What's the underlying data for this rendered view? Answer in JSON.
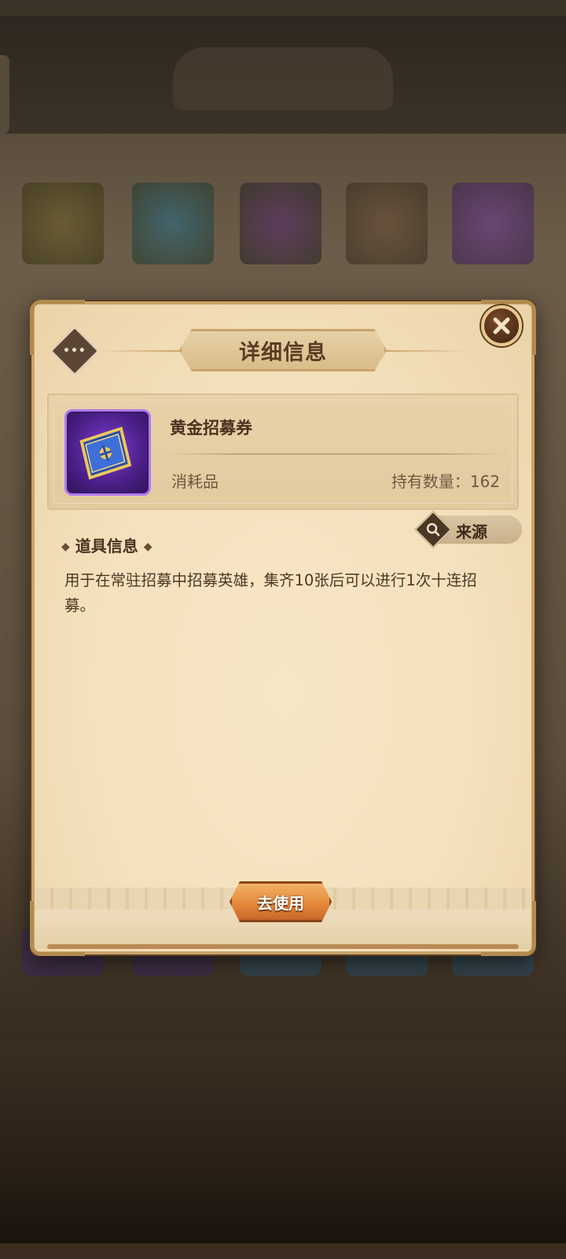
{
  "dialog": {
    "title": "详细信息",
    "menu_glyph": "•••"
  },
  "item": {
    "name": "黄金招募券",
    "type": "消耗品",
    "owned_label": "持有数量：",
    "owned_count": "162",
    "icon": "golden-recruit-ticket-icon"
  },
  "source_button": {
    "label": "来源",
    "icon": "search-icon"
  },
  "info": {
    "section_title": "道具信息",
    "description": "用于在常驻招募中招募英雄，集齐10张后可以进行1次十连招募。"
  },
  "actions": {
    "use_label": "去使用",
    "close_icon": "close-icon"
  },
  "colors": {
    "parchment": "#f4e1bd",
    "frame_gold": "#c9a36a",
    "title_brown": "#5a3c22",
    "use_button_orange": "#e58a3a",
    "item_rarity_purple": "#7e3ed0"
  }
}
